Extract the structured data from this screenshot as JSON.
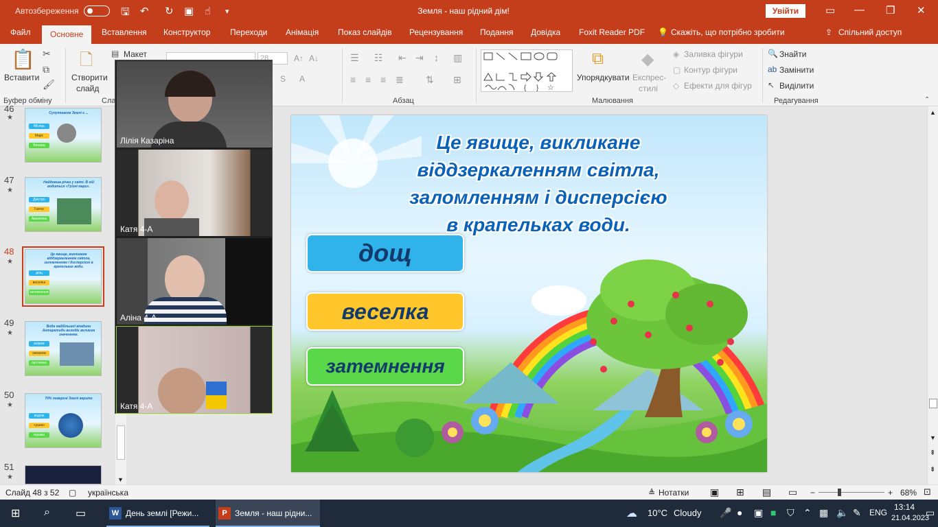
{
  "titlebar": {
    "autosave_label": "Автозбереження",
    "title": "Земля - наш рідний дім!",
    "signin": "Увійти"
  },
  "tabs": [
    "Файл",
    "Основне",
    "Вставлення",
    "Конструктор",
    "Переходи",
    "Анімація",
    "Показ слайдів",
    "Рецензування",
    "Подання",
    "Довідка",
    "Foxit Reader PDF"
  ],
  "tell_me": "Скажіть, що потрібно зробити",
  "share": "Спільний доступ",
  "ribbon": {
    "paste": "Вставити",
    "clipboard_group": "Буфер обміну",
    "new_slide_1": "Створити",
    "new_slide_2": "слайд",
    "layout": "Макет",
    "slides_group": "Сла",
    "font_size": "28",
    "paragraph_group": "Абзац",
    "arrange": "Упорядкувати",
    "quick_styles_1": "Експрес-",
    "quick_styles_2": "стилі",
    "shape_fill": "Заливка фігури",
    "shape_outline": "Контур фігури",
    "shape_effects": "Ефекти для фігур",
    "drawing_group": "Малювання",
    "find": "Знайти",
    "replace": "Замінити",
    "select": "Виділити",
    "editing_group": "Редагування"
  },
  "thumbnails": [
    {
      "num": "46",
      "title": "Супутником Землі є ...",
      "buttons": [
        "Місяць",
        "Марс",
        "Венера"
      ]
    },
    {
      "num": "47",
      "title": "Найдовша річка у світі. В ній водиться «Грізні мари».",
      "buttons": [
        "Дністро",
        "Гангес",
        "Амазонка"
      ]
    },
    {
      "num": "48",
      "title": "Це явище, викликане віддзеркаленням світла, заломленням і дисперсією в крапельках води.",
      "buttons": [
        "дощ",
        "веселка",
        "затемнення"
      ]
    },
    {
      "num": "49",
      "title": "Вода найбільшої впадини Антарктиди володіє великим значенням.",
      "buttons": [
        "морем",
        "океаном",
        "пустелею"
      ]
    },
    {
      "num": "50",
      "title": "70% поверхні Землі вкрито",
      "buttons": [
        "водою",
        "сушею",
        "горами"
      ]
    },
    {
      "num": "51",
      "title": "",
      "buttons": []
    }
  ],
  "video": [
    {
      "name": "Лілія Казаріна"
    },
    {
      "name": "Катя 4-А"
    },
    {
      "name": "Аліна 4-А"
    },
    {
      "name": "Катя  4-А"
    }
  ],
  "slide": {
    "title_lines": [
      "Це явище, викликане",
      "віддзеркаленням світла,",
      "заломленням і дисперсією",
      "в крапельках води."
    ],
    "answers": [
      {
        "label": "дощ",
        "color": "#2fb3ea"
      },
      {
        "label": "веселка",
        "color": "#ffc72c"
      },
      {
        "label": "затемнення",
        "color": "#5ad84a"
      }
    ]
  },
  "statusbar": {
    "slide_info": "Слайд 48 з 52",
    "language": "українська",
    "notes": "Нотатки",
    "zoom": "68%"
  },
  "taskbar": {
    "app_word": "День землі [Режи...",
    "app_ppt": "Земля - наш рідни...",
    "weather_temp": "10°C",
    "weather_desc": "Cloudy",
    "lang": "ENG",
    "time": "13:14",
    "date": "21.04.2023"
  }
}
